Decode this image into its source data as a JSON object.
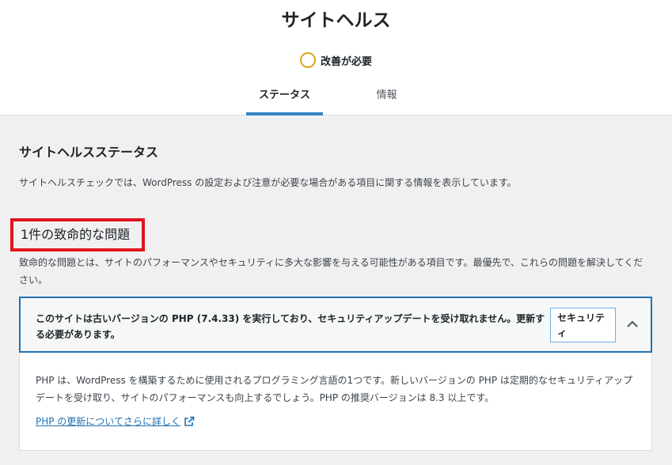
{
  "header": {
    "title": "サイトヘルス",
    "status_text": "改善が必要",
    "status_color": "#dba617",
    "tabs": [
      {
        "label": "ステータス",
        "active": true
      },
      {
        "label": "情報",
        "active": false
      }
    ]
  },
  "main": {
    "heading": "サイトヘルスステータス",
    "description": "サイトヘルスチェックでは、WordPress の設定および注意が必要な場合がある項目に関する情報を表示しています。",
    "critical": {
      "title": "1件の致命的な問題",
      "description": "致命的な問題とは、サイトのパフォーマンスやセキュリティに多大な影響を与える可能性がある項目です。最優先で、これらの問題を解決してください。"
    },
    "issue": {
      "title": "このサイトは古いバージョンの PHP (7.4.33) を実行しており、セキュリティアップデートを受け取れません。更新する必要があります。",
      "badge": "セキュリティ",
      "expanded": true,
      "body": "PHP は、WordPress を構築するために使用されるプログラミング言語の1つです。新しいバージョンの PHP は定期的なセキュリティアップデートを受け取り、サイトのパフォーマンスも向上するでしょう。PHP の推奨バージョンは 8.3 以上です。",
      "link_text": "PHP の更新についてさらに詳しく",
      "link_icon": "external-link-icon",
      "toggle_icon": "chevron-up-icon"
    }
  },
  "colors": {
    "accent": "#2271b1",
    "highlight": "#e0141e"
  }
}
